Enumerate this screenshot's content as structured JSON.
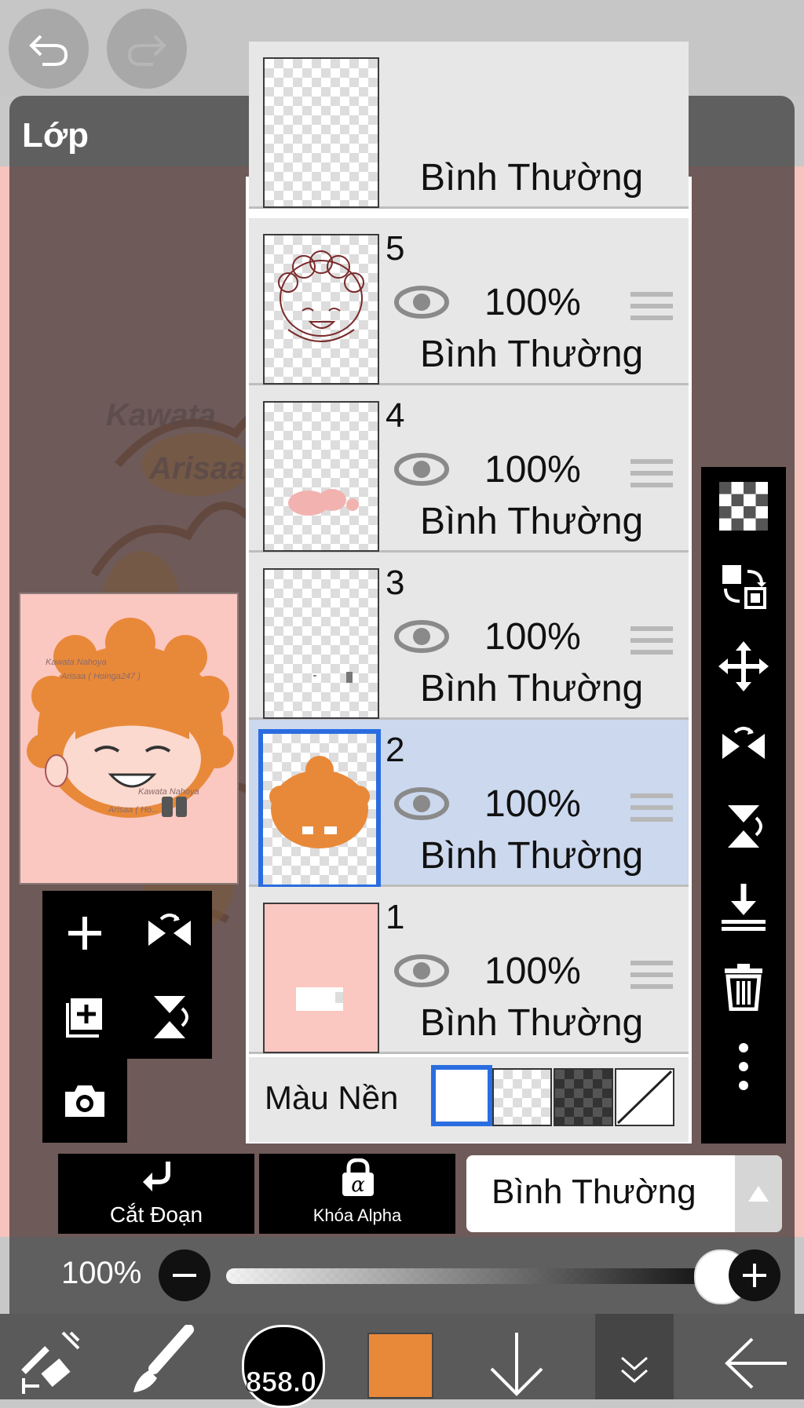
{
  "panel_title": "Lớp",
  "preview": {
    "watermark_line1": "Kawata Nahoya",
    "watermark_line2": "Arisaa ( Hoinga247 )",
    "watermark_line3": "Kawata Nahoya",
    "watermark_line4": "Arisaa ( Ho..."
  },
  "partial_layer": {
    "blend": "Bình Thường"
  },
  "layers": [
    {
      "number": "5",
      "opacity": "100%",
      "blend": "Bình Thường",
      "selected": false
    },
    {
      "number": "4",
      "opacity": "100%",
      "blend": "Bình Thường",
      "selected": false
    },
    {
      "number": "3",
      "opacity": "100%",
      "blend": "Bình Thường",
      "selected": false
    },
    {
      "number": "2",
      "opacity": "100%",
      "blend": "Bình Thường",
      "selected": true
    },
    {
      "number": "1",
      "opacity": "100%",
      "blend": "Bình Thường",
      "selected": false
    }
  ],
  "background": {
    "label": "Màu Nền"
  },
  "actions": {
    "clip_label": "Cắt Đoạn",
    "alpha_lock_label": "Khóa Alpha",
    "blend_mode_value": "Bình Thường"
  },
  "opacity": {
    "label": "100%",
    "value": 1.0
  },
  "bottom": {
    "brush_size": "858.0",
    "color": "#e8893a"
  },
  "colors": {
    "selected_layer": "#cbd8ee",
    "selection_border": "#2a6de0",
    "canvas_pink": "#fbc7c1",
    "hair_orange": "#e8893a"
  }
}
